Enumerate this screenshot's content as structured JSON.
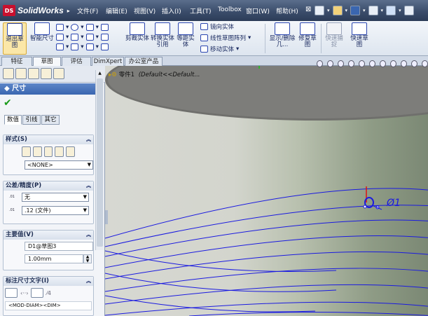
{
  "app": {
    "name": "SolidWorks",
    "logo": "DS"
  },
  "menu": [
    "文件(F)",
    "编辑(E)",
    "视图(V)",
    "插入(I)",
    "工具(T)",
    "Toolbox",
    "窗口(W)",
    "帮助(H)"
  ],
  "command_manager": {
    "exit_sketch": "退出草图",
    "smart_dim": "智能尺寸",
    "trim": "剪裁实体",
    "convert": "转换实体引用",
    "offset": "等距实体",
    "mirror": "镜向实体",
    "linear_pattern": "线性草图阵列",
    "move": "移动实体",
    "display_delete": "显示/删除几...",
    "repair": "修复草图",
    "quick_snaps": "快速捕捉",
    "rapid_sketch": "快速草图"
  },
  "tabs": [
    "特征",
    "草图",
    "评估",
    "DimXpert",
    "办公室产品"
  ],
  "active_tab": 1,
  "tree": {
    "root": "零件1",
    "config": "(Default<<Default..."
  },
  "property_manager": {
    "title": "尺寸",
    "subtabs": [
      "数值",
      "引线",
      "其它"
    ],
    "style": {
      "title": "样式(S)",
      "value": "<NONE>"
    },
    "tolerance": {
      "title": "公差/精度(P)",
      "tol_type": "无",
      "precision": ".12 (文件)"
    },
    "primary": {
      "title": "主要值(V)",
      "name": "D1@草图3",
      "value": "1.00mm"
    },
    "dim_text": {
      "title": "标注尺寸文字(I)",
      "text": "<MOD-DIAM><DIM>"
    },
    "tolerance_icons": [
      ".01",
      ".01"
    ]
  },
  "dimension_label": "Ø1",
  "colors": {
    "accent": "#3a66b0",
    "helix": "#1a1ae0",
    "origin_red": "#e01010",
    "origin_green": "#18c818"
  }
}
